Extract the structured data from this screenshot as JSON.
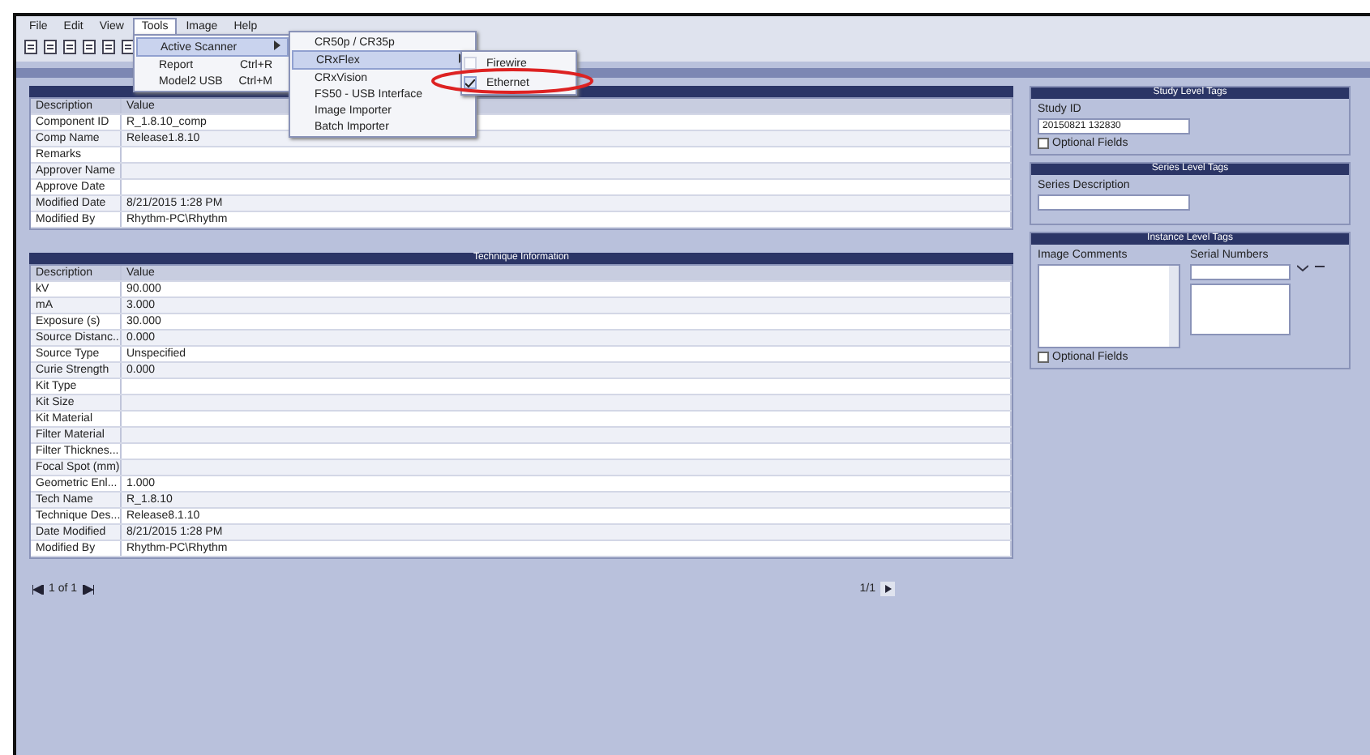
{
  "menubar": [
    {
      "label": "File",
      "selected": false
    },
    {
      "label": "Edit",
      "selected": false
    },
    {
      "label": "View",
      "selected": false
    },
    {
      "label": "Tools",
      "selected": true
    },
    {
      "label": "Image",
      "selected": false
    },
    {
      "label": "Help",
      "selected": false
    }
  ],
  "tools_menu": [
    {
      "kind": "submenu",
      "label": "Active Scanner",
      "selected": true
    },
    {
      "kind": "command",
      "label": "Report",
      "shortcut": "Ctrl+R",
      "selected": false
    },
    {
      "kind": "command",
      "label": "Model2 USB",
      "shortcut": "Ctrl+M",
      "selected": false
    }
  ],
  "scanner_menu": [
    {
      "kind": "command",
      "label": "CR50p / CR35p",
      "selected": false
    },
    {
      "kind": "submenu",
      "label": "CRxFlex",
      "selected": true
    },
    {
      "kind": "command",
      "label": "CRxVision",
      "selected": false
    },
    {
      "kind": "command",
      "label": "FS50 - USB Interface",
      "selected": false
    },
    {
      "kind": "command",
      "label": "Image Importer",
      "selected": false
    },
    {
      "kind": "command",
      "label": "Batch Importer",
      "selected": false
    }
  ],
  "connection_menu": [
    {
      "label": "Firewire",
      "checked": false
    },
    {
      "label": "Ethernet",
      "checked": true
    }
  ],
  "component_table": {
    "columns": [
      "Description",
      "Value"
    ],
    "rows": [
      {
        "label": "Component ID",
        "value": "R_1.8.10_comp"
      },
      {
        "label": "Comp Name",
        "value": "Release1.8.10"
      },
      {
        "label": "Remarks"
      },
      {
        "label": "Approver Name"
      },
      {
        "label": "Approve Date"
      },
      {
        "label": "Modified Date",
        "value": "8/21/2015 1:28 PM"
      },
      {
        "label": "Modified By",
        "value": "Rhythm-PC\\Rhythm"
      }
    ]
  },
  "technique_table": {
    "title": "Technique Information",
    "columns": [
      "Description",
      "Value"
    ],
    "rows": [
      {
        "label": "kV",
        "value": "90.000"
      },
      {
        "label": "mA",
        "value": "3.000"
      },
      {
        "label": "Exposure (s)",
        "value": "30.000"
      },
      {
        "label": "Source Distanc...",
        "value": "0.000"
      },
      {
        "label": "Source Type",
        "value": "Unspecified"
      },
      {
        "label": "Curie Strength",
        "value": "0.000"
      },
      {
        "label": "Kit Type"
      },
      {
        "label": "Kit Size"
      },
      {
        "label": "Kit Material"
      },
      {
        "label": "Filter Material"
      },
      {
        "label": "Filter Thicknes..."
      },
      {
        "label": "Focal Spot (mm)"
      },
      {
        "label": "Geometric Enl...",
        "value": "1.000"
      },
      {
        "label": "Tech Name",
        "value": "R_1.8.10"
      },
      {
        "label": "Technique Des...",
        "value": "Release8.1.10"
      },
      {
        "label": "Date Modified",
        "value": "8/21/2015 1:28 PM"
      },
      {
        "label": "Modified By",
        "value": "Rhythm-PC\\Rhythm"
      }
    ]
  },
  "pager": {
    "text": "1 of 1",
    "count": "1/1"
  },
  "study_tags": {
    "title": "Study Level Tags",
    "study_id_label": "Study ID",
    "study_id": "20150821 132830",
    "optional_fields": {
      "label": "Optional Fields",
      "checked": false
    }
  },
  "series_tags": {
    "title": "Series Level Tags",
    "description_label": "Series Description"
  },
  "instance_tags": {
    "title": "Instance Level Tags",
    "comments_label": "Image Comments",
    "serial_label": "Serial Numbers",
    "optional_fields": {
      "label": "Optional Fields",
      "checked": false
    }
  }
}
